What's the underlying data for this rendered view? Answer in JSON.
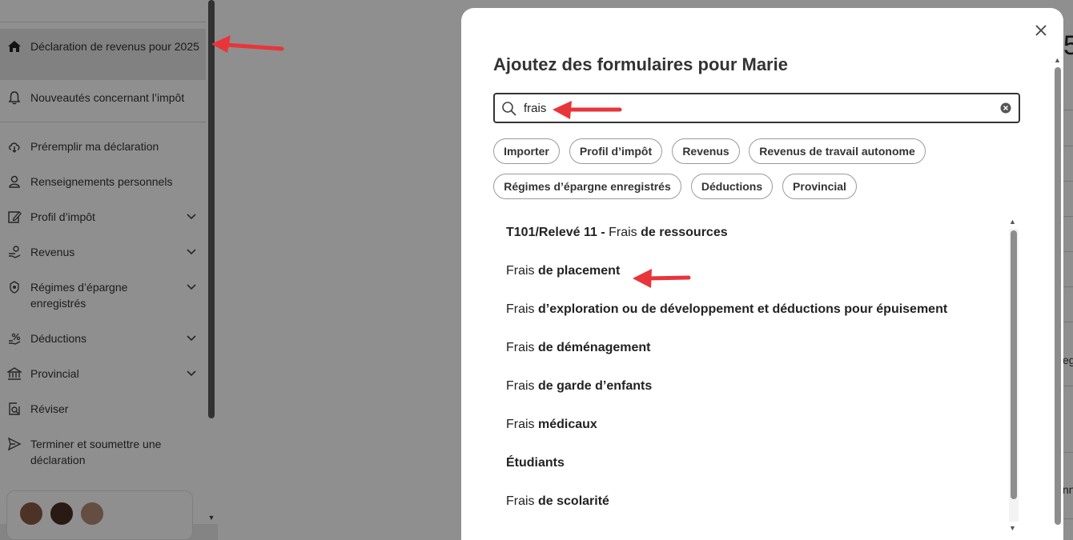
{
  "sidebar": {
    "items": [
      {
        "label": "Déclaration de revenus pour 2025",
        "icon": "home-icon"
      },
      {
        "label": "Nouveautés concernant l’impôt",
        "icon": "bell-icon"
      },
      {
        "label": "Préremplir ma déclaration",
        "icon": "cloud-download-icon"
      },
      {
        "label": "Renseignements personnels",
        "icon": "person-icon"
      },
      {
        "label": "Profil d’impôt",
        "icon": "edit-icon"
      },
      {
        "label": "Revenus",
        "icon": "income-icon"
      },
      {
        "label": "Régimes d’épargne enregistrés",
        "icon": "savings-icon"
      },
      {
        "label": "Déductions",
        "icon": "deductions-icon"
      },
      {
        "label": "Provincial",
        "icon": "government-icon"
      },
      {
        "label": "Réviser",
        "icon": "review-icon"
      },
      {
        "label": "Terminer et soumettre une déclaration",
        "icon": "send-icon"
      }
    ]
  },
  "main": {
    "digit": "5",
    "frag_1": "eg",
    "frag_2": "nn"
  },
  "modal": {
    "title": "Ajoutez des formulaires pour Marie",
    "search": {
      "value": "frais",
      "placeholder": ""
    },
    "chips": [
      "Importer",
      "Profil d’impôt",
      "Revenus",
      "Revenus de travail autonome",
      "Régimes d’épargne enregistrés",
      "Déductions",
      "Provincial"
    ],
    "results": [
      {
        "bold_prefix": "T101/Relevé 11 - ",
        "plain": "Frais",
        "bold": " de ressources"
      },
      {
        "bold_prefix": "",
        "plain": "Frais",
        "bold": " de placement"
      },
      {
        "bold_prefix": "",
        "plain": "Frais",
        "bold": " d’exploration ou de développement et déductions pour épuisement"
      },
      {
        "bold_prefix": "",
        "plain": "Frais",
        "bold": " de déménagement"
      },
      {
        "bold_prefix": "",
        "plain": "Frais",
        "bold": " de garde d’enfants"
      },
      {
        "bold_prefix": "",
        "plain": "Frais",
        "bold": " médicaux"
      },
      {
        "bold_prefix": "Étudiants",
        "plain": "",
        "bold": ""
      },
      {
        "bold_prefix": "",
        "plain": "Frais",
        "bold": " de scolarité"
      }
    ]
  },
  "colors": {
    "annotation_arrow": "#e8353a",
    "overlay": "rgba(0,0,0,0.44)"
  }
}
